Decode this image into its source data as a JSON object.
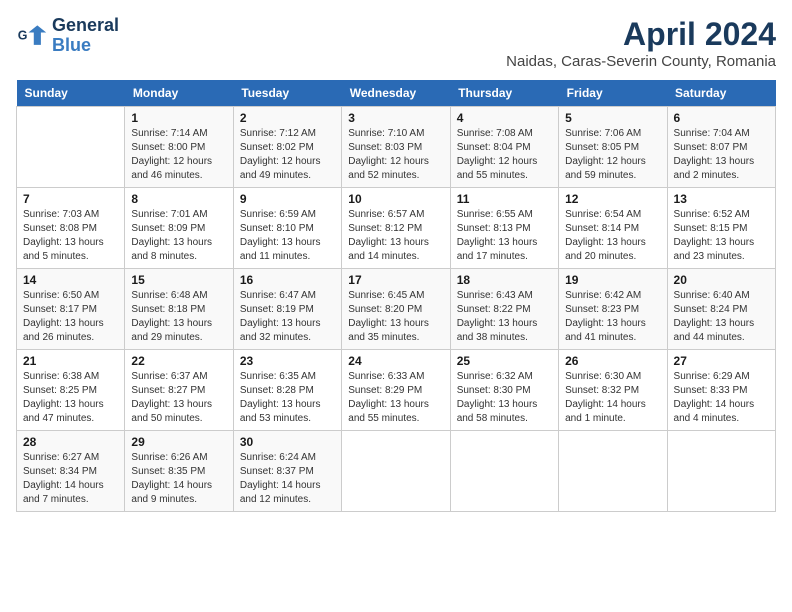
{
  "header": {
    "logo_line1": "General",
    "logo_line2": "Blue",
    "title": "April 2024",
    "subtitle": "Naidas, Caras-Severin County, Romania"
  },
  "weekdays": [
    "Sunday",
    "Monday",
    "Tuesday",
    "Wednesday",
    "Thursday",
    "Friday",
    "Saturday"
  ],
  "weeks": [
    [
      {
        "day": "",
        "info": ""
      },
      {
        "day": "1",
        "info": "Sunrise: 7:14 AM\nSunset: 8:00 PM\nDaylight: 12 hours\nand 46 minutes."
      },
      {
        "day": "2",
        "info": "Sunrise: 7:12 AM\nSunset: 8:02 PM\nDaylight: 12 hours\nand 49 minutes."
      },
      {
        "day": "3",
        "info": "Sunrise: 7:10 AM\nSunset: 8:03 PM\nDaylight: 12 hours\nand 52 minutes."
      },
      {
        "day": "4",
        "info": "Sunrise: 7:08 AM\nSunset: 8:04 PM\nDaylight: 12 hours\nand 55 minutes."
      },
      {
        "day": "5",
        "info": "Sunrise: 7:06 AM\nSunset: 8:05 PM\nDaylight: 12 hours\nand 59 minutes."
      },
      {
        "day": "6",
        "info": "Sunrise: 7:04 AM\nSunset: 8:07 PM\nDaylight: 13 hours\nand 2 minutes."
      }
    ],
    [
      {
        "day": "7",
        "info": "Sunrise: 7:03 AM\nSunset: 8:08 PM\nDaylight: 13 hours\nand 5 minutes."
      },
      {
        "day": "8",
        "info": "Sunrise: 7:01 AM\nSunset: 8:09 PM\nDaylight: 13 hours\nand 8 minutes."
      },
      {
        "day": "9",
        "info": "Sunrise: 6:59 AM\nSunset: 8:10 PM\nDaylight: 13 hours\nand 11 minutes."
      },
      {
        "day": "10",
        "info": "Sunrise: 6:57 AM\nSunset: 8:12 PM\nDaylight: 13 hours\nand 14 minutes."
      },
      {
        "day": "11",
        "info": "Sunrise: 6:55 AM\nSunset: 8:13 PM\nDaylight: 13 hours\nand 17 minutes."
      },
      {
        "day": "12",
        "info": "Sunrise: 6:54 AM\nSunset: 8:14 PM\nDaylight: 13 hours\nand 20 minutes."
      },
      {
        "day": "13",
        "info": "Sunrise: 6:52 AM\nSunset: 8:15 PM\nDaylight: 13 hours\nand 23 minutes."
      }
    ],
    [
      {
        "day": "14",
        "info": "Sunrise: 6:50 AM\nSunset: 8:17 PM\nDaylight: 13 hours\nand 26 minutes."
      },
      {
        "day": "15",
        "info": "Sunrise: 6:48 AM\nSunset: 8:18 PM\nDaylight: 13 hours\nand 29 minutes."
      },
      {
        "day": "16",
        "info": "Sunrise: 6:47 AM\nSunset: 8:19 PM\nDaylight: 13 hours\nand 32 minutes."
      },
      {
        "day": "17",
        "info": "Sunrise: 6:45 AM\nSunset: 8:20 PM\nDaylight: 13 hours\nand 35 minutes."
      },
      {
        "day": "18",
        "info": "Sunrise: 6:43 AM\nSunset: 8:22 PM\nDaylight: 13 hours\nand 38 minutes."
      },
      {
        "day": "19",
        "info": "Sunrise: 6:42 AM\nSunset: 8:23 PM\nDaylight: 13 hours\nand 41 minutes."
      },
      {
        "day": "20",
        "info": "Sunrise: 6:40 AM\nSunset: 8:24 PM\nDaylight: 13 hours\nand 44 minutes."
      }
    ],
    [
      {
        "day": "21",
        "info": "Sunrise: 6:38 AM\nSunset: 8:25 PM\nDaylight: 13 hours\nand 47 minutes."
      },
      {
        "day": "22",
        "info": "Sunrise: 6:37 AM\nSunset: 8:27 PM\nDaylight: 13 hours\nand 50 minutes."
      },
      {
        "day": "23",
        "info": "Sunrise: 6:35 AM\nSunset: 8:28 PM\nDaylight: 13 hours\nand 53 minutes."
      },
      {
        "day": "24",
        "info": "Sunrise: 6:33 AM\nSunset: 8:29 PM\nDaylight: 13 hours\nand 55 minutes."
      },
      {
        "day": "25",
        "info": "Sunrise: 6:32 AM\nSunset: 8:30 PM\nDaylight: 13 hours\nand 58 minutes."
      },
      {
        "day": "26",
        "info": "Sunrise: 6:30 AM\nSunset: 8:32 PM\nDaylight: 14 hours\nand 1 minute."
      },
      {
        "day": "27",
        "info": "Sunrise: 6:29 AM\nSunset: 8:33 PM\nDaylight: 14 hours\nand 4 minutes."
      }
    ],
    [
      {
        "day": "28",
        "info": "Sunrise: 6:27 AM\nSunset: 8:34 PM\nDaylight: 14 hours\nand 7 minutes."
      },
      {
        "day": "29",
        "info": "Sunrise: 6:26 AM\nSunset: 8:35 PM\nDaylight: 14 hours\nand 9 minutes."
      },
      {
        "day": "30",
        "info": "Sunrise: 6:24 AM\nSunset: 8:37 PM\nDaylight: 14 hours\nand 12 minutes."
      },
      {
        "day": "",
        "info": ""
      },
      {
        "day": "",
        "info": ""
      },
      {
        "day": "",
        "info": ""
      },
      {
        "day": "",
        "info": ""
      }
    ]
  ]
}
